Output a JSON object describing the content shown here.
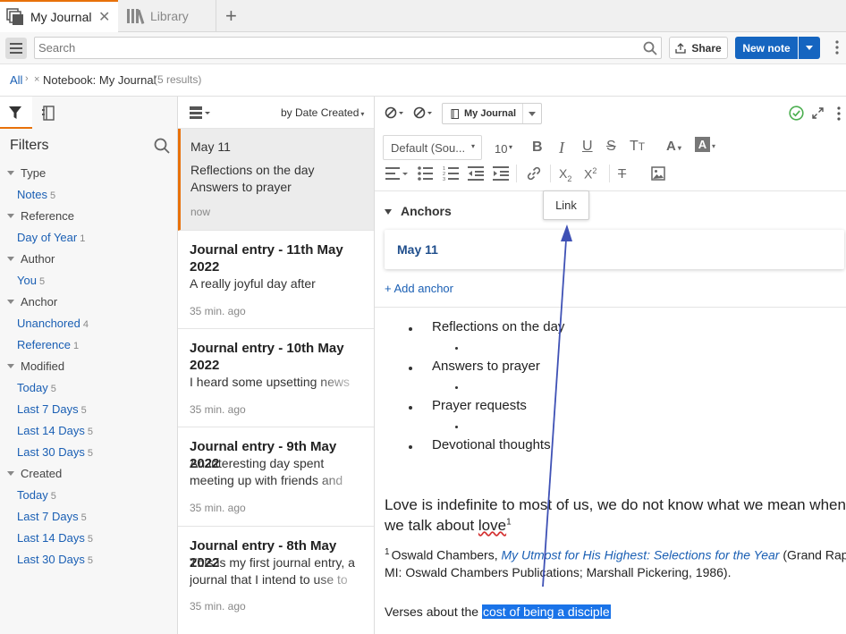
{
  "tabs": [
    {
      "label": "My Journal"
    },
    {
      "label": "Library"
    }
  ],
  "toolbar": {
    "search_placeholder": "Search",
    "share_label": "Share",
    "new_note_label": "New note"
  },
  "breadcrumb": {
    "all": "All",
    "notebook": "Notebook: My Journal",
    "results": "(5 results)"
  },
  "filters": {
    "title": "Filters",
    "groups": [
      {
        "label": "Type",
        "items": [
          {
            "label": "Notes",
            "count": "5"
          }
        ]
      },
      {
        "label": "Reference",
        "items": [
          {
            "label": "Day of Year",
            "count": "1"
          }
        ]
      },
      {
        "label": "Author",
        "items": [
          {
            "label": "You",
            "count": "5"
          }
        ]
      },
      {
        "label": "Anchor",
        "items": [
          {
            "label": "Unanchored",
            "count": "4"
          },
          {
            "label": "Reference",
            "count": "1"
          }
        ]
      },
      {
        "label": "Modified",
        "items": [
          {
            "label": "Today",
            "count": "5"
          },
          {
            "label": "Last 7 Days",
            "count": "5"
          },
          {
            "label": "Last 14 Days",
            "count": "5"
          },
          {
            "label": "Last 30 Days",
            "count": "5"
          }
        ]
      },
      {
        "label": "Created",
        "items": [
          {
            "label": "Today",
            "count": "5"
          },
          {
            "label": "Last 7 Days",
            "count": "5"
          },
          {
            "label": "Last 14 Days",
            "count": "5"
          },
          {
            "label": "Last 30 Days",
            "count": "5"
          }
        ]
      }
    ]
  },
  "notes_list": {
    "sort_label": "by Date Created",
    "items": [
      {
        "date": "May 11",
        "line1": "Reflections on the day",
        "line2": "Answers to prayer",
        "time": "now"
      },
      {
        "title1": "Journal entry - 11th May",
        "title2": "2022",
        "body1": "A really joyful day after",
        "time": "35 min. ago"
      },
      {
        "title1": "Journal entry - 10th May",
        "title2": "2022",
        "body1": "I heard some upsetting news",
        "time": "35 min. ago"
      },
      {
        "title1": "Journal entry - 9th May 2022",
        "body1": "An interesting day spent",
        "body2": "meeting up with friends and",
        "time": "35 min. ago"
      },
      {
        "title1": "Journal entry - 8th May 2022",
        "body1": "This is my first journal entry, a",
        "body2": "journal that I intend to use to",
        "time": "35 min. ago"
      }
    ]
  },
  "editor": {
    "notebook_label": "My Journal",
    "font_label": "Default (Sou...",
    "size_label": "10",
    "tooltip": "Link",
    "anchors_title": "Anchors",
    "anchor_item": "May 11",
    "add_anchor": "+ Add anchor",
    "bullets": [
      "Reflections on the day",
      "Answers to prayer",
      "Prayer requests",
      "Devotional thoughts"
    ],
    "quote_line1": "Love is indefinite to most of us, we do not know what we mean when",
    "quote_line2_pre": "we talk about ",
    "quote_line2_word": "love",
    "footnote_mark": "1",
    "footnote_author": "Oswald Chambers, ",
    "footnote_title": "My Utmost for His Highest: Selections for the Year",
    "footnote_rest1": " (Grand Rapids,",
    "footnote_rest2": "MI: Oswald Chambers Publications; Marshall Pickering, 1986).",
    "verses_pre": "Verses about the ",
    "verses_selected": "cost of being a disciple"
  },
  "colors": {
    "accent": "#1565c0",
    "tab_accent": "#e8710a",
    "selection": "#1a73e8",
    "check": "#4caf50",
    "annotation_arrow": "#3f51b5"
  }
}
